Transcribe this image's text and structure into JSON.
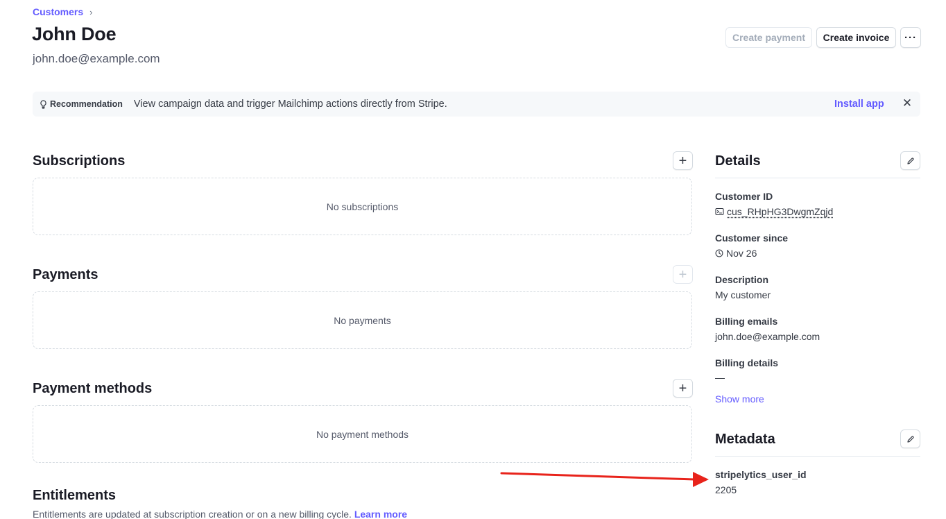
{
  "breadcrumb": {
    "parent": "Customers",
    "separator": "›"
  },
  "customer": {
    "name": "John Doe",
    "email": "john.doe@example.com"
  },
  "toolbar": {
    "create_payment": "Create payment",
    "create_invoice": "Create invoice",
    "more": "···"
  },
  "banner": {
    "label": "Recommendation",
    "text": "View campaign data and trigger Mailchimp actions directly from Stripe.",
    "action": "Install app",
    "close": "✕"
  },
  "sections": {
    "subscriptions": {
      "title": "Subscriptions",
      "empty": "No subscriptions",
      "add": "+"
    },
    "payments": {
      "title": "Payments",
      "empty": "No payments",
      "add": "+"
    },
    "payment_methods": {
      "title": "Payment methods",
      "empty": "No payment methods",
      "add": "+"
    },
    "entitlements": {
      "title": "Entitlements",
      "description": "Entitlements are updated at subscription creation or on a new billing cycle.",
      "link": "Learn more"
    }
  },
  "details": {
    "title": "Details",
    "customer_id_label": "Customer ID",
    "customer_id": "cus_RHpHG3DwgmZqjd",
    "customer_since_label": "Customer since",
    "customer_since": "Nov 26",
    "description_label": "Description",
    "description": "My customer",
    "billing_emails_label": "Billing emails",
    "billing_emails": "john.doe@example.com",
    "billing_details_label": "Billing details",
    "billing_details": "—",
    "show_more": "Show more"
  },
  "metadata": {
    "title": "Metadata",
    "key": "stripelytics_user_id",
    "value": "2205"
  },
  "colors": {
    "accent": "#635bff",
    "annotation_arrow": "#e8231b"
  }
}
